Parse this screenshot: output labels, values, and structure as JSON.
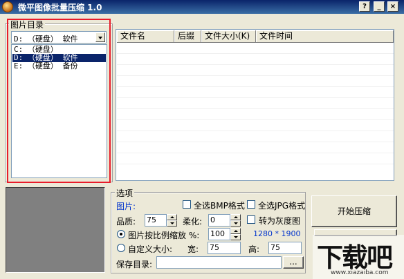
{
  "window": {
    "title": "微平图像批量压缩 1.0",
    "help_label": "?",
    "minimize_label": "_",
    "close_label": "×"
  },
  "folder_panel": {
    "caption": "图片目录",
    "selected_drive": "D: （硬盘） 软件",
    "drives": [
      {
        "label": "C: （硬盘）",
        "selected": false
      },
      {
        "label": "D: （硬盘） 软件",
        "selected": true
      },
      {
        "label": "E: （硬盘） 备份",
        "selected": false
      }
    ]
  },
  "file_table": {
    "columns": [
      "文件名",
      "后缀",
      "文件大小(K)",
      "文件时间"
    ],
    "rows": []
  },
  "annotation": {
    "highlight_color": "#e81c2a"
  },
  "options": {
    "caption": "选项",
    "image_heading": "图片:",
    "select_all_bmp": "全选BMP格式",
    "select_all_jpg": "全选JPG格式",
    "quality_label": "品质:",
    "quality_value": "75",
    "soften_label": "柔化:",
    "soften_value": "0",
    "grayscale_label": "转为灰度图",
    "scale_label": "图片按比例缩放 %:",
    "scale_value": "100",
    "resolution": "1280 * 1900",
    "custom_size_label": "自定义大小:",
    "width_label": "宽:",
    "width_value": "75",
    "height_label": "高:",
    "height_value": "75",
    "save_dir_label": "保存目录:",
    "save_dir_value": "",
    "browse_label": "..."
  },
  "actions": {
    "start_label": "开始压缩"
  },
  "watermark": {
    "brand": "下载吧",
    "site": "www.xiazaiba.com"
  }
}
